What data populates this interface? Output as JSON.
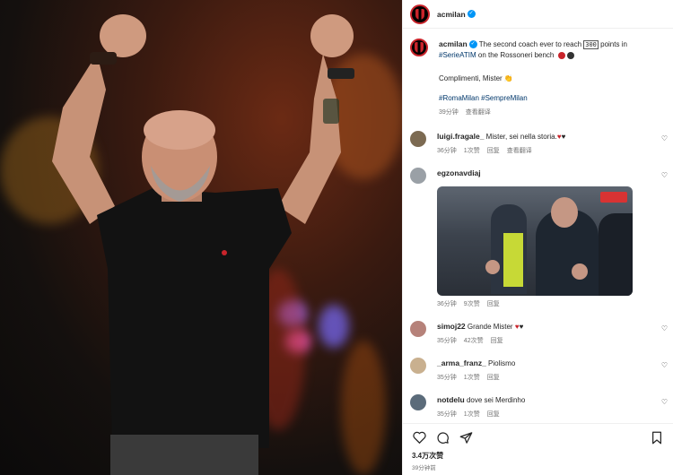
{
  "post": {
    "username": "acmilan",
    "caption_user": "acmilan",
    "caption_line1": "The second coach ever to reach ",
    "caption_number": "300",
    "caption_line1b": " points in",
    "caption_hashtag1": "#SerieATIM",
    "caption_line2": " on the Rossoneri bench",
    "caption_complimenti": "Complimenti, Mister",
    "caption_hashtags": "#RomaMilan #SempreMilan",
    "caption_time": "39分钟",
    "caption_translate": "查看翻译"
  },
  "comments": [
    {
      "user": "luigi.fragale_",
      "text": "Mister, sei nella storia.",
      "time": "36分钟",
      "likes": "1次赞",
      "reply": "回复",
      "translate": "查看翻译"
    },
    {
      "user": "egzonavdiaj",
      "text": "",
      "time": "36分钟",
      "likes": "9次赞",
      "reply": "回复"
    },
    {
      "user": "simoj22",
      "text": "Grande Mister",
      "time": "35分钟",
      "likes": "42次赞",
      "reply": "回复"
    },
    {
      "user": "_arma_franz_",
      "text": "Piolismo",
      "time": "35分钟",
      "likes": "1次赞",
      "reply": "回复"
    },
    {
      "user": "notdelu",
      "text": "dove sei Merdinho",
      "time": "35分钟",
      "likes": "1次赞",
      "reply": "回复"
    }
  ],
  "footer": {
    "likes": "3.4万次赞",
    "time": "39分钟前"
  },
  "colors": {
    "red": "#c9242b",
    "link": "#00376b",
    "verified": "#0095f6"
  }
}
